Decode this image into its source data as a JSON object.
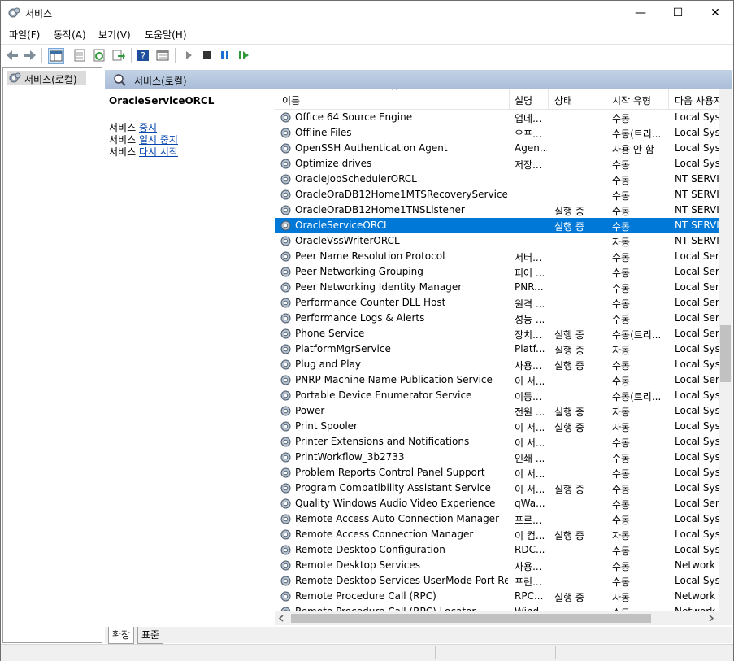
{
  "window": {
    "title": "서비스",
    "minimize_glyph": "—",
    "maximize_glyph": "☐",
    "close_glyph": "✕"
  },
  "menu": [
    "파일(F)",
    "동작(A)",
    "보기(V)",
    "도움말(H)"
  ],
  "toolbar_icons": [
    "back-icon",
    "forward-icon",
    "show-tree-icon",
    "properties-icon",
    "refresh-icon",
    "export-icon",
    "help-icon",
    "console-view-icon",
    "start-icon",
    "stop-icon",
    "pause-icon",
    "restart-icon"
  ],
  "tree": {
    "label": "서비스(로컬)"
  },
  "right_header": {
    "label": "서비스(로컬)"
  },
  "detail": {
    "title": "OracleServiceORCL",
    "lines": [
      {
        "prefix": "서비스 ",
        "link": "중지"
      },
      {
        "prefix": "서비스 ",
        "link": "일시 중지"
      },
      {
        "prefix": "서비스 ",
        "link": "다시 시작"
      }
    ]
  },
  "columns": [
    "이름",
    "설명",
    "상태",
    "시작 유형",
    "다음 사용자"
  ],
  "sort_glyph": "^",
  "selected_row_index": 7,
  "rows": [
    [
      "Office 64 Source Engine",
      "업데...",
      "",
      "수동",
      "Local Syst"
    ],
    [
      "Offline Files",
      "오프...",
      "",
      "수동(트리...",
      "Local Syst"
    ],
    [
      "OpenSSH Authentication Agent",
      "Agen...",
      "",
      "사용 안 함",
      "Local Syst"
    ],
    [
      "Optimize drives",
      "저장...",
      "",
      "수동",
      "Local Syst"
    ],
    [
      "OracleJobSchedulerORCL",
      "",
      "",
      "수동",
      "NT SERVIC"
    ],
    [
      "OracleOraDB12Home1MTSRecoveryService",
      "",
      "",
      "수동",
      "NT SERVIC"
    ],
    [
      "OracleOraDB12Home1TNSListener",
      "",
      "실행 중",
      "수동",
      "NT SERVIC"
    ],
    [
      "OracleServiceORCL",
      "",
      "실행 중",
      "수동",
      "NT SERVIC"
    ],
    [
      "OracleVssWriterORCL",
      "",
      "",
      "자동",
      "NT SERVIC"
    ],
    [
      "Peer Name Resolution Protocol",
      "서버...",
      "",
      "수동",
      "Local Serv"
    ],
    [
      "Peer Networking Grouping",
      "피어 ...",
      "",
      "수동",
      "Local Serv"
    ],
    [
      "Peer Networking Identity Manager",
      "PNR...",
      "",
      "수동",
      "Local Serv"
    ],
    [
      "Performance Counter DLL Host",
      "원격 ...",
      "",
      "수동",
      "Local Serv"
    ],
    [
      "Performance Logs & Alerts",
      "성능 ...",
      "",
      "수동",
      "Local Serv"
    ],
    [
      "Phone Service",
      "장치...",
      "실행 중",
      "수동(트리...",
      "Local Serv"
    ],
    [
      "PlatformMgrService",
      "Platf...",
      "실행 중",
      "자동",
      "Local Syst"
    ],
    [
      "Plug and Play",
      "사용...",
      "실행 중",
      "수동",
      "Local Syst"
    ],
    [
      "PNRP Machine Name Publication Service",
      "이 서...",
      "",
      "수동",
      "Local Serv"
    ],
    [
      "Portable Device Enumerator Service",
      "이동...",
      "",
      "수동(트리...",
      "Local Syst"
    ],
    [
      "Power",
      "전원 ...",
      "실행 중",
      "자동",
      "Local Syst"
    ],
    [
      "Print Spooler",
      "이 서...",
      "실행 중",
      "자동",
      "Local Syst"
    ],
    [
      "Printer Extensions and Notifications",
      "이 서...",
      "",
      "수동",
      "Local Syst"
    ],
    [
      "PrintWorkflow_3b2733",
      "인쇄 ...",
      "",
      "수동",
      "Local Syst"
    ],
    [
      "Problem Reports Control Panel Support",
      "이 서...",
      "",
      "수동",
      "Local Syst"
    ],
    [
      "Program Compatibility Assistant Service",
      "이 서...",
      "실행 중",
      "수동",
      "Local Syst"
    ],
    [
      "Quality Windows Audio Video Experience",
      "qWa...",
      "",
      "수동",
      "Local Serv"
    ],
    [
      "Remote Access Auto Connection Manager",
      "프로...",
      "",
      "수동",
      "Local Syst"
    ],
    [
      "Remote Access Connection Manager",
      "이 컴...",
      "실행 중",
      "자동",
      "Local Syst"
    ],
    [
      "Remote Desktop Configuration",
      "RDC...",
      "",
      "수동",
      "Local Syst"
    ],
    [
      "Remote Desktop Services",
      "사용...",
      "",
      "수동",
      "Network S"
    ],
    [
      "Remote Desktop Services UserMode Port Redir...",
      "프린...",
      "",
      "수동",
      "Local Syst"
    ],
    [
      "Remote Procedure Call (RPC)",
      "RPC...",
      "실행 중",
      "자동",
      "Network S"
    ],
    [
      "Remote Procedure Call (RPC) Locator",
      "Wind...",
      "",
      "수동",
      "Network S"
    ]
  ],
  "tabs": [
    "확장",
    "표준"
  ],
  "colors": {
    "selection": "#0078d7",
    "header_gradient_top": "#c3d2e5",
    "header_gradient_bottom": "#a9bcd8"
  }
}
